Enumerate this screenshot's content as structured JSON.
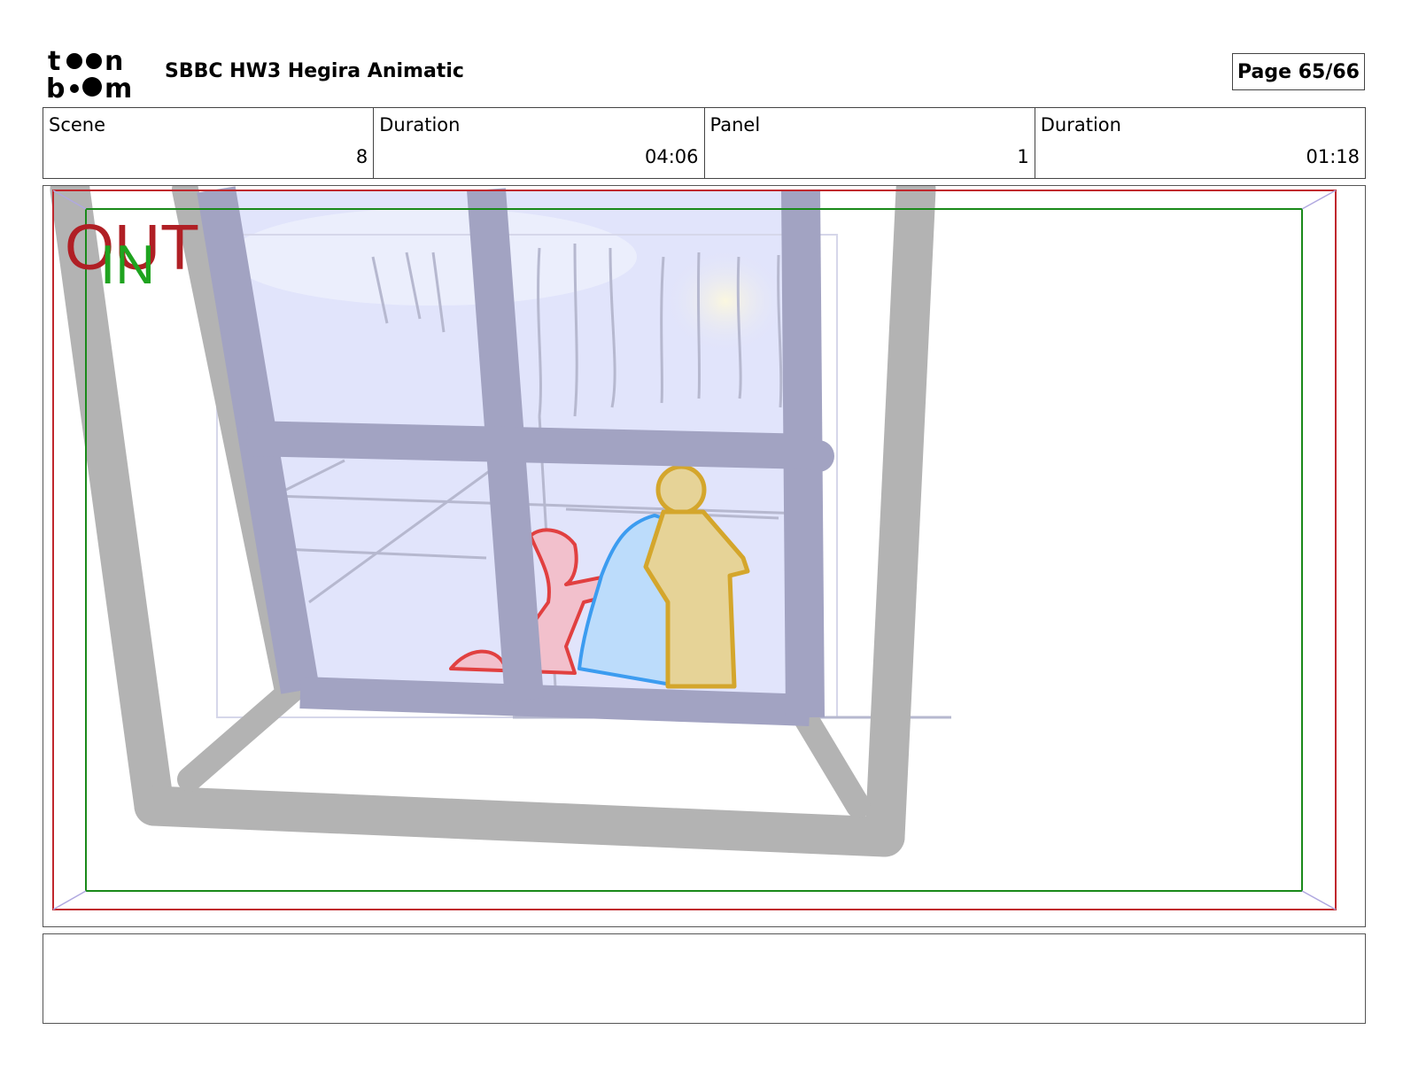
{
  "header": {
    "logo_text_line1": "toon",
    "logo_text_line2": "boom",
    "title": "SBBC HW3 Hegira Animatic",
    "page": "Page 65/66"
  },
  "info": {
    "scene_label": "Scene",
    "scene_value": "8",
    "scene_duration_label": "Duration",
    "scene_duration_value": "04:06",
    "panel_label": "Panel",
    "panel_value": "1",
    "panel_duration_label": "Duration",
    "panel_duration_value": "01:18"
  },
  "frame_labels": {
    "out": "OUT",
    "in": "IN"
  },
  "notes": {
    "text": ""
  },
  "colors": {
    "out_frame": "#c0272d",
    "in_frame": "#1a8a1a",
    "window_frame": "#a2a3c2",
    "sill_gray": "#b3b3b3",
    "sky": "#e1e4fb",
    "char_red": "#e14040",
    "char_blue": "#3c9cf0",
    "char_yellow": "#d4a62c"
  }
}
